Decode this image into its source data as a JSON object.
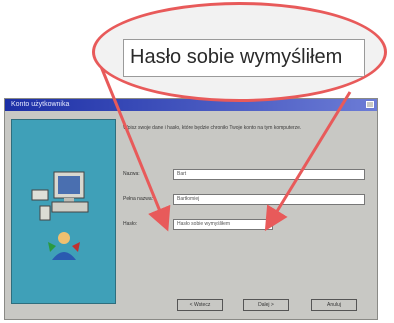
{
  "zoom": {
    "text": "Hasło sobie wymyśliłem"
  },
  "window": {
    "title": "Konto użytkownika"
  },
  "dialog": {
    "description": "Wpisz swoje dane i hasło, które będzie chroniło Twoje konto na tym komputerze.",
    "fields": [
      {
        "label": "Nazwa:",
        "value": "Bart"
      },
      {
        "label": "Pełna nazwa:",
        "value": "Bartłomiej"
      },
      {
        "label": "Hasło:",
        "value": "Hasło sobie wymyśliłem"
      }
    ],
    "buttons": {
      "back": "< Wstecz",
      "next": "Dalej >",
      "cancel": "Anuluj"
    }
  },
  "colors": {
    "accent": "#e85a5a",
    "titlebar": "#1c2fa6",
    "panel": "#3fa0b8"
  }
}
